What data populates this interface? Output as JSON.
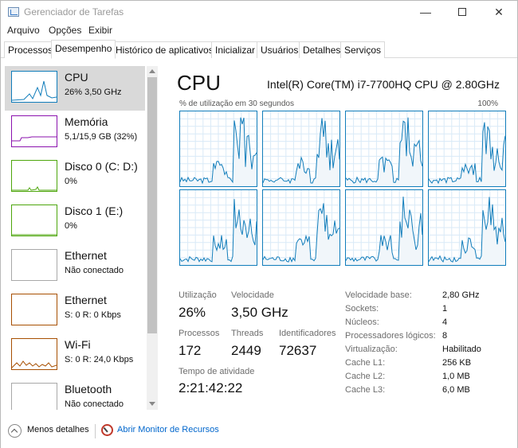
{
  "window": {
    "title": "Gerenciador de Tarefas",
    "controls": {
      "minimize": "—",
      "close": "✕"
    }
  },
  "menu": [
    "Arquivo",
    "Opções",
    "Exibir"
  ],
  "tabs": [
    "Processos",
    "Desempenho",
    "Histórico de aplicativos",
    "Inicializar",
    "Usuários",
    "Detalhes",
    "Serviços"
  ],
  "active_tab": "Desempenho",
  "sidebar": [
    {
      "name": "CPU",
      "sub": "26%  3,50 GHz",
      "color": "#117dbb",
      "selected": true
    },
    {
      "name": "Memória",
      "sub": "5,1/15,9 GB (32%)",
      "color": "#8b12ae",
      "selected": false
    },
    {
      "name": "Disco 0 (C: D:)",
      "sub": "0%",
      "color": "#4da60c",
      "selected": false
    },
    {
      "name": "Disco 1 (E:)",
      "sub": "0%",
      "color": "#4da60c",
      "selected": false
    },
    {
      "name": "Ethernet",
      "sub": "Não conectado",
      "color": "#a8a8a8",
      "selected": false
    },
    {
      "name": "Ethernet",
      "sub": "S: 0  R: 0 Kbps",
      "color": "#a74f01",
      "selected": false
    },
    {
      "name": "Wi-Fi",
      "sub": "S: 0  R: 24,0 Kbps",
      "color": "#a74f01",
      "selected": false
    },
    {
      "name": "Bluetooth",
      "sub": "Não conectado",
      "color": "#a8a8a8",
      "selected": false
    }
  ],
  "cpu": {
    "title": "CPU",
    "model": "Intel(R) Core(TM) i7-7700HQ CPU @ 2.80GHz",
    "graph_caption": "% de utilização em 30 segundos",
    "graph_max": "100%",
    "logical_processor_graphs": 8,
    "accent_color": "#117dbb"
  },
  "stats": {
    "utilization_label": "Utilização",
    "utilization": "26%",
    "speed_label": "Velocidade",
    "speed": "3,50 GHz",
    "processes_label": "Processos",
    "processes": "172",
    "threads_label": "Threads",
    "threads": "2449",
    "handles_label": "Identificadores",
    "handles": "72637",
    "uptime_label": "Tempo de atividade",
    "uptime": "2:21:42:22"
  },
  "specs": [
    {
      "label": "Velocidade base:",
      "value": "2,80 GHz"
    },
    {
      "label": "Sockets:",
      "value": "1"
    },
    {
      "label": "Núcleos:",
      "value": "4"
    },
    {
      "label": "Processadores lógicos:",
      "value": "8"
    },
    {
      "label": "Virtualização:",
      "value": "Habilitado"
    },
    {
      "label": "Cache L1:",
      "value": "256 KB"
    },
    {
      "label": "Cache L2:",
      "value": "1,0 MB"
    },
    {
      "label": "Cache L3:",
      "value": "6,0 MB"
    }
  ],
  "footer": {
    "less_details": "Menos detalhes",
    "open_monitor": "Abrir Monitor de Recursos"
  }
}
